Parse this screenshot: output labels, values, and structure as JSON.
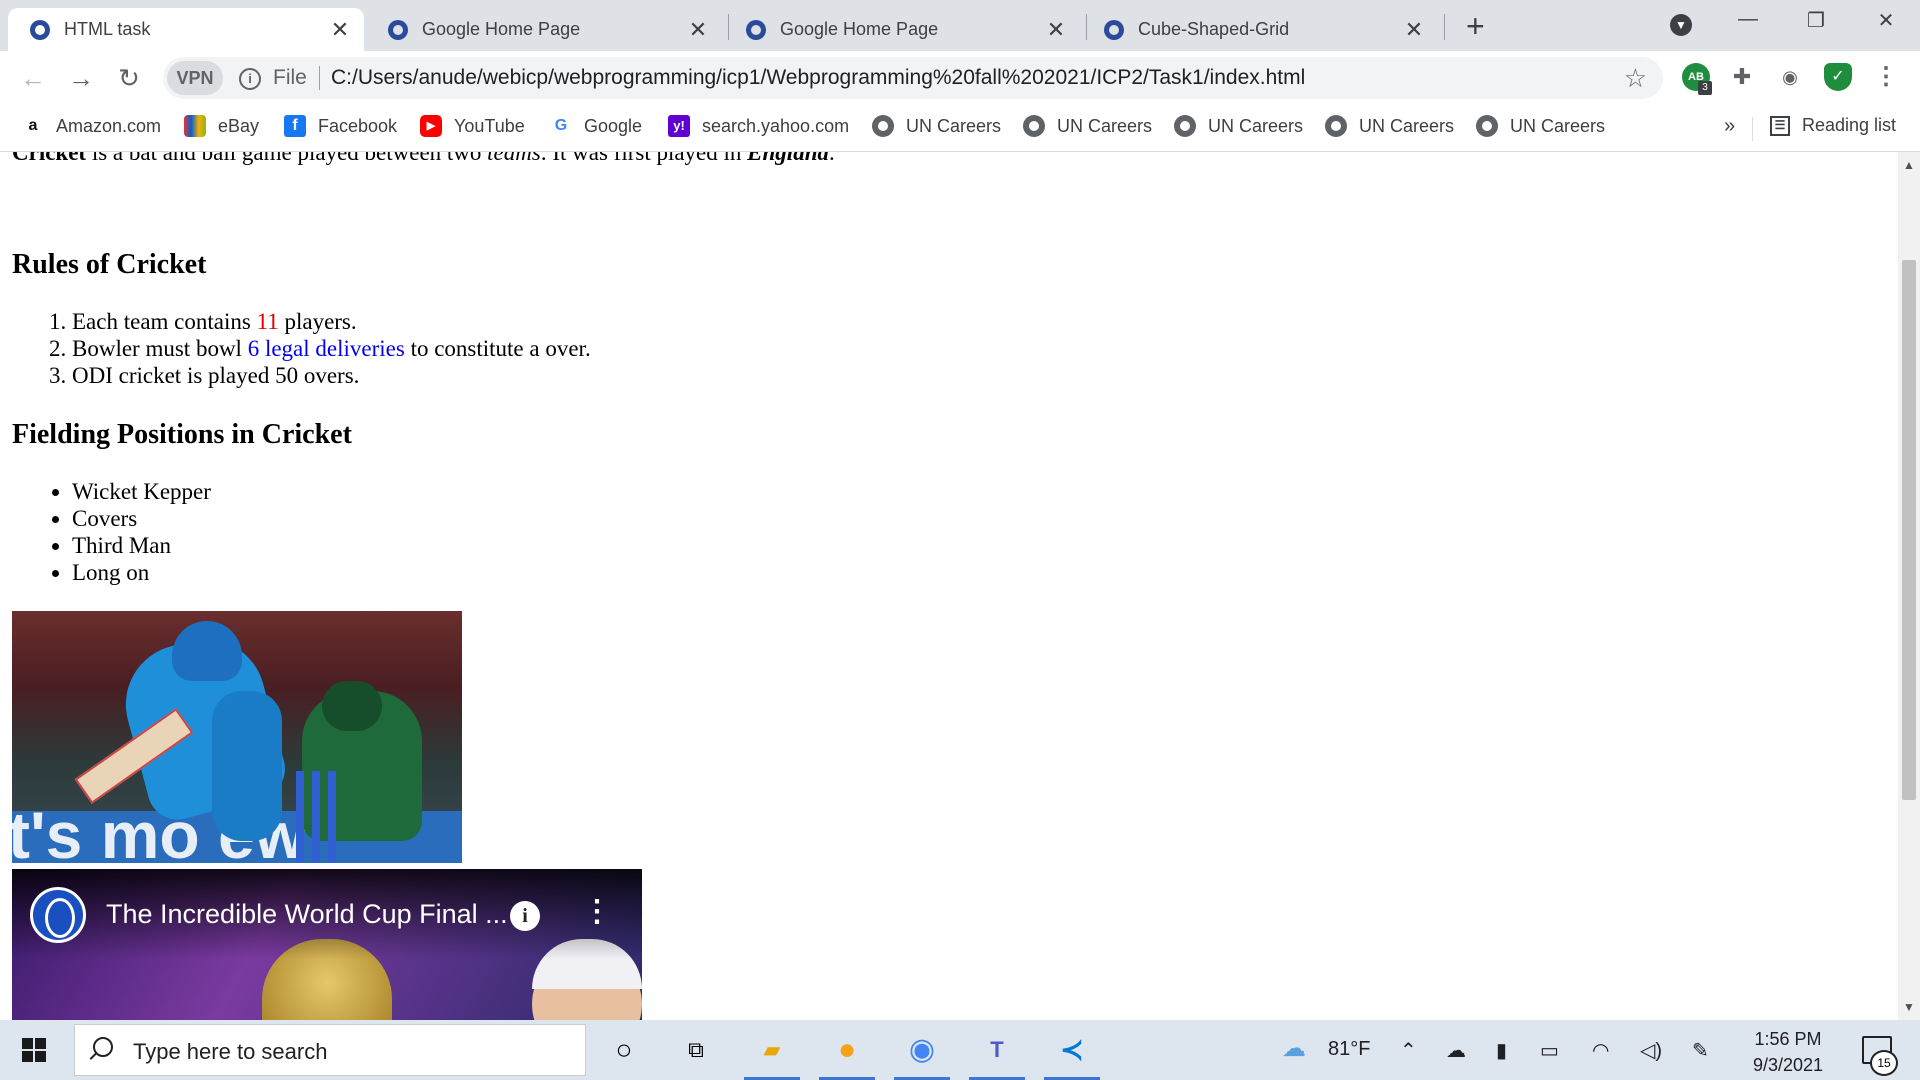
{
  "browser": {
    "tabs": [
      {
        "label": "HTML task",
        "active": true
      },
      {
        "label": "Google Home Page",
        "active": false
      },
      {
        "label": "Google Home Page",
        "active": false
      },
      {
        "label": "Cube-Shaped-Grid",
        "active": false
      }
    ],
    "address": {
      "vpn_label": "VPN",
      "scheme_label": "File",
      "url": "C:/Users/anude/webicp/webprogramming/icp1/Webprogramming%20fall%202021/ICP2/Task1/index.html"
    },
    "extensions": {
      "badge_count": "3",
      "ab_label": "AB"
    },
    "bookmarks": [
      {
        "label": "Amazon.com",
        "icon": "amazon-icon"
      },
      {
        "label": "eBay",
        "icon": "ebay-icon"
      },
      {
        "label": "Facebook",
        "icon": "facebook-icon"
      },
      {
        "label": "YouTube",
        "icon": "youtube-icon"
      },
      {
        "label": "Google",
        "icon": "google-icon"
      },
      {
        "label": "search.yahoo.com",
        "icon": "yahoo-icon"
      },
      {
        "label": "UN Careers",
        "icon": "globe-icon"
      },
      {
        "label": "UN Careers",
        "icon": "globe-icon"
      },
      {
        "label": "UN Careers",
        "icon": "globe-icon"
      },
      {
        "label": "UN Careers",
        "icon": "globe-icon"
      },
      {
        "label": "UN Careers",
        "icon": "globe-icon"
      }
    ],
    "overflow_label": "»",
    "reading_list_label": "Reading list"
  },
  "page": {
    "intro": {
      "part1": "Cricket",
      "part2": " is a bat and ball game played between two ",
      "part3": "teams",
      "part4": ". It was first played in ",
      "part5": "England",
      "part6": "."
    },
    "rules_heading": "Rules of Cricket",
    "rules": [
      {
        "pre": "Each team contains ",
        "highlight": "11",
        "post": " players."
      },
      {
        "pre": "Bowler must bowl ",
        "highlight": "6 legal deliveries",
        "post": " to constitute a over."
      },
      {
        "pre": "ODI cricket is played 50 overs.",
        "highlight": "",
        "post": ""
      }
    ],
    "fielding_heading": "Fielding Positions in Cricket",
    "fielding": [
      "Wicket Kepper",
      "Covers",
      "Third Man",
      "Long on"
    ],
    "image_banner_text": "t's mo          ew",
    "video_title": "The Incredible World Cup Final ...",
    "colors": {
      "rule_number": "#e00000",
      "rule_link": "#0000ee"
    }
  },
  "taskbar": {
    "search_placeholder": "Type here to search",
    "weather": "81°F",
    "time": "1:56 PM",
    "date": "9/3/2021",
    "notification_count": "15"
  }
}
